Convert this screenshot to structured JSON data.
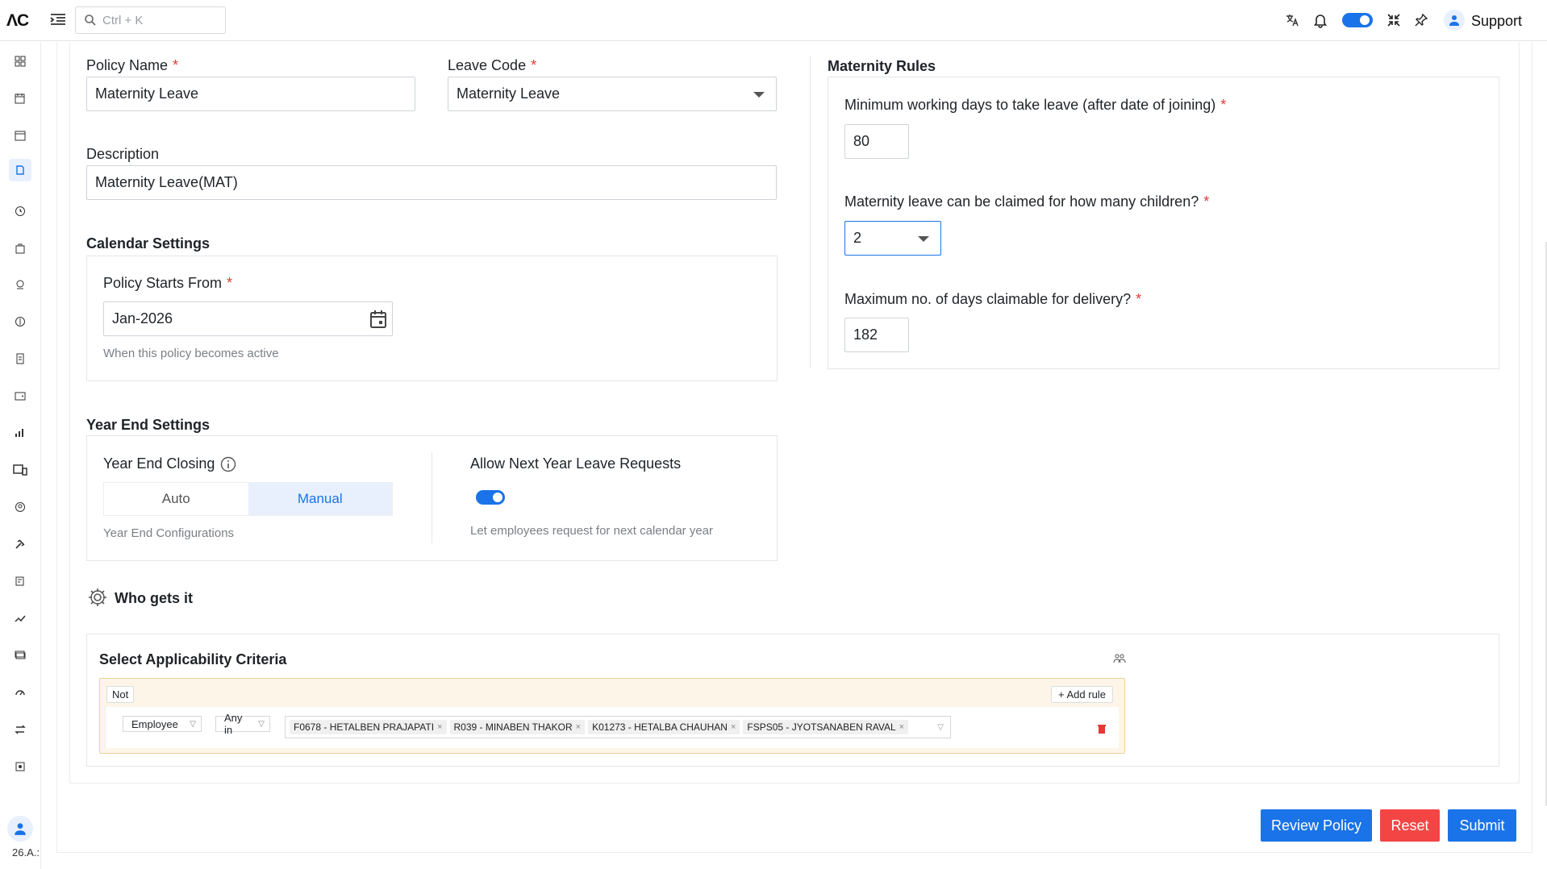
{
  "app": {
    "logo": "ΛC",
    "search_placeholder": "Ctrl + K",
    "support_label": "Support",
    "version": "26.A.:"
  },
  "policy": {
    "name_label": "Policy Name",
    "name_value": "Maternity Leave",
    "code_label": "Leave Code",
    "code_value": "Maternity Leave",
    "description_label": "Description",
    "description_value": "Maternity Leave(MAT)"
  },
  "calendar": {
    "title": "Calendar Settings",
    "starts_label": "Policy Starts From",
    "starts_value": "Jan-2026",
    "starts_hint": "When this policy becomes active"
  },
  "year_end": {
    "title": "Year End Settings",
    "closing_label": "Year End Closing",
    "options": [
      "Auto",
      "Manual"
    ],
    "selected": "Manual",
    "closing_hint": "Year End Configurations",
    "next_year_label": "Allow Next Year Leave Requests",
    "next_year_enabled": true,
    "next_year_hint": "Let employees request for next calendar year"
  },
  "maternity_rules": {
    "title": "Maternity Rules",
    "min_days_label": "Minimum working days to take leave (after date of joining)",
    "min_days_value": "80",
    "children_label": "Maternity leave can be claimed for how many children?",
    "children_value": "2",
    "max_days_label": "Maximum no. of days claimable for delivery?",
    "max_days_value": "182"
  },
  "who_gets_it": {
    "title": "Who gets it",
    "criteria_title": "Select Applicability Criteria",
    "not_label": "Not",
    "add_rule_label": "Add rule",
    "field_select": "Employee",
    "operator_select": "Any in",
    "tags": [
      "F0678 - HETALBEN PRAJAPATI",
      "R039 - MINABEN THAKOR",
      "K01273 - HETALBA CHAUHAN",
      "FSPS05 - JYOTSANABEN RAVAL"
    ]
  },
  "actions": {
    "review": "Review Policy",
    "reset": "Reset",
    "submit": "Submit"
  },
  "colors": {
    "primary": "#1a73e8",
    "danger": "#f44545",
    "rule_bg": "#fdf6e8"
  }
}
